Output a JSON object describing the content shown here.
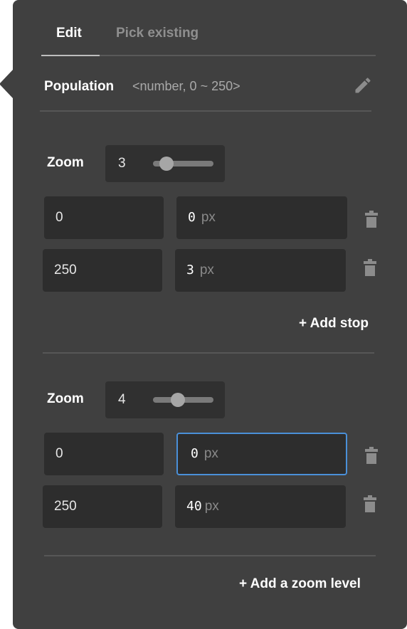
{
  "tabs": [
    {
      "label": "Edit",
      "active": true
    },
    {
      "label": "Pick existing",
      "active": false
    }
  ],
  "property": {
    "name": "Population",
    "type_hint": "<number, 0 ~ 250>"
  },
  "zoom_groups": [
    {
      "zoom_label": "Zoom",
      "zoom_value": "3",
      "slider_fraction": 0.22,
      "stops": [
        {
          "input": "0",
          "output": "0",
          "unit": "px"
        },
        {
          "input": "250",
          "output": "3",
          "unit": "px"
        }
      ],
      "add_stop_label": "+ Add stop"
    },
    {
      "zoom_label": "Zoom",
      "zoom_value": "4",
      "slider_fraction": 0.41,
      "stops": [
        {
          "input": "0",
          "output": "0",
          "unit": "px",
          "focused": true
        },
        {
          "input": "250",
          "output": "40",
          "unit": "px"
        }
      ]
    }
  ],
  "add_zoom_level_label": "+ Add a zoom level",
  "colors": {
    "panel": "#404040",
    "field": "#2d2d2d",
    "focus": "#4a90d9",
    "muted_text": "#8f8f8f"
  },
  "icons": {
    "edit": "pencil-icon",
    "delete": "trash-icon"
  }
}
